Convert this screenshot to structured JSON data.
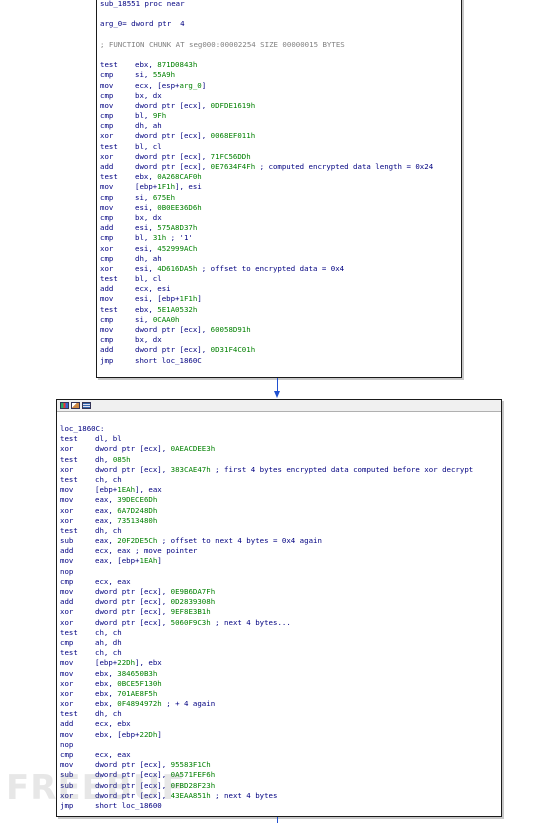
{
  "block1": {
    "lines": [
      {
        "t": "plain",
        "text": "sub_18551 proc near"
      },
      {
        "t": "blank"
      },
      {
        "t": "plain",
        "text": "arg_0= dword ptr  4"
      },
      {
        "t": "blank"
      },
      {
        "t": "comment",
        "text": "; FUNCTION CHUNK AT seg000:00002254 SIZE 00000015 BYTES"
      },
      {
        "t": "blank"
      },
      {
        "t": "ins",
        "m": "test",
        "o": "ebx, 871D0843h"
      },
      {
        "t": "ins",
        "m": "cmp",
        "o": "si, 55A9h"
      },
      {
        "t": "ins",
        "m": "mov",
        "o": "ecx, [esp+arg_0]"
      },
      {
        "t": "ins",
        "m": "cmp",
        "o": "bx, dx"
      },
      {
        "t": "ins",
        "m": "mov",
        "o": "dword ptr [ecx], 0DFDE1619h"
      },
      {
        "t": "ins",
        "m": "cmp",
        "o": "bl, 9Fh"
      },
      {
        "t": "ins",
        "m": "cmp",
        "o": "dh, ah"
      },
      {
        "t": "ins",
        "m": "xor",
        "o": "dword ptr [ecx], 0068EF011h"
      },
      {
        "t": "ins",
        "m": "test",
        "o": "bl, cl"
      },
      {
        "t": "ins",
        "m": "xor",
        "o": "dword ptr [ecx], 71FC56DDh"
      },
      {
        "t": "ins",
        "m": "add",
        "o": "dword ptr [ecx], 0E7634F4Fh",
        "c": "; computed encrypted data length = 0x24"
      },
      {
        "t": "ins",
        "m": "test",
        "o": "ebx, 0A268CAF0h"
      },
      {
        "t": "ins",
        "m": "mov",
        "o": "[ebp+1F1h], esi"
      },
      {
        "t": "ins",
        "m": "cmp",
        "o": "si, 675Eh"
      },
      {
        "t": "ins",
        "m": "mov",
        "o": "esi, 0B0EE36D6h"
      },
      {
        "t": "ins",
        "m": "cmp",
        "o": "bx, dx"
      },
      {
        "t": "ins",
        "m": "add",
        "o": "esi, 575A8D37h"
      },
      {
        "t": "ins",
        "m": "cmp",
        "o": "bl, 31h ; '1'"
      },
      {
        "t": "ins",
        "m": "xor",
        "o": "esi, 452999ACh"
      },
      {
        "t": "ins",
        "m": "cmp",
        "o": "dh, ah"
      },
      {
        "t": "ins",
        "m": "xor",
        "o": "esi, 4D616DA5h",
        "c": "; offset to encrypted data = 0x4"
      },
      {
        "t": "ins",
        "m": "test",
        "o": "bl, cl"
      },
      {
        "t": "ins",
        "m": "add",
        "o": "ecx, esi"
      },
      {
        "t": "ins",
        "m": "mov",
        "o": "esi, [ebp+1F1h]"
      },
      {
        "t": "ins",
        "m": "test",
        "o": "ebx, 5E1A0532h"
      },
      {
        "t": "ins",
        "m": "cmp",
        "o": "si, 0CAA0h"
      },
      {
        "t": "ins",
        "m": "mov",
        "o": "dword ptr [ecx], 60058D91h"
      },
      {
        "t": "ins",
        "m": "cmp",
        "o": "bx, dx"
      },
      {
        "t": "ins",
        "m": "add",
        "o": "dword ptr [ecx], 0D31F4C01h"
      },
      {
        "t": "ins",
        "m": "jmp",
        "o": "short loc_1860C"
      }
    ]
  },
  "block2": {
    "lines": [
      {
        "t": "plain",
        "text": "loc_1860C:"
      },
      {
        "t": "ins",
        "m": "test",
        "o": "dl, bl"
      },
      {
        "t": "ins",
        "m": "xor",
        "o": "dword ptr [ecx], 0AEACDEE3h"
      },
      {
        "t": "ins",
        "m": "test",
        "o": "dh, 085h"
      },
      {
        "t": "ins",
        "m": "xor",
        "o": "dword ptr [ecx], 383CAE47h",
        "c": "; first 4 bytes encrypted data computed before xor decrypt"
      },
      {
        "t": "ins",
        "m": "test",
        "o": "ch, ch"
      },
      {
        "t": "ins",
        "m": "mov",
        "o": "[ebp+1EAh], eax"
      },
      {
        "t": "ins",
        "m": "mov",
        "o": "eax, 39DECE6Dh"
      },
      {
        "t": "ins",
        "m": "xor",
        "o": "eax, 6A7D248Dh"
      },
      {
        "t": "ins",
        "m": "xor",
        "o": "eax, 73513480h"
      },
      {
        "t": "ins",
        "m": "test",
        "o": "dh, ch"
      },
      {
        "t": "ins",
        "m": "sub",
        "o": "eax, 20F2DE5Ch",
        "c": "; offset to next 4 bytes = 0x4 again"
      },
      {
        "t": "ins",
        "m": "add",
        "o": "ecx, eax",
        "c": "; move pointer"
      },
      {
        "t": "ins",
        "m": "mov",
        "o": "eax, [ebp+1EAh]"
      },
      {
        "t": "ins",
        "m": "nop",
        "o": ""
      },
      {
        "t": "ins",
        "m": "cmp",
        "o": "ecx, eax"
      },
      {
        "t": "ins",
        "m": "mov",
        "o": "dword ptr [ecx], 0E9B6DA7Fh"
      },
      {
        "t": "ins",
        "m": "add",
        "o": "dword ptr [ecx], 0D2839308h"
      },
      {
        "t": "ins",
        "m": "xor",
        "o": "dword ptr [ecx], 9EF8E3B1h"
      },
      {
        "t": "ins",
        "m": "xor",
        "o": "dword ptr [ecx], 5060F9C3h",
        "c": "; next 4 bytes..."
      },
      {
        "t": "ins",
        "m": "test",
        "o": "ch, ch"
      },
      {
        "t": "ins",
        "m": "cmp",
        "o": "ah, dh"
      },
      {
        "t": "ins",
        "m": "test",
        "o": "ch, ch"
      },
      {
        "t": "ins",
        "m": "mov",
        "o": "[ebp+22Dh], ebx"
      },
      {
        "t": "ins",
        "m": "mov",
        "o": "ebx, 384650B3h"
      },
      {
        "t": "ins",
        "m": "xor",
        "o": "ebx, 0BCE5F130h"
      },
      {
        "t": "ins",
        "m": "xor",
        "o": "ebx, 701AE8F5h"
      },
      {
        "t": "ins",
        "m": "xor",
        "o": "ebx, 0F4894972h",
        "c": "; + 4 again"
      },
      {
        "t": "ins",
        "m": "test",
        "o": "dh, ch"
      },
      {
        "t": "ins",
        "m": "add",
        "o": "ecx, ebx"
      },
      {
        "t": "ins",
        "m": "mov",
        "o": "ebx, [ebp+22Dh]"
      },
      {
        "t": "ins",
        "m": "nop",
        "o": ""
      },
      {
        "t": "ins",
        "m": "cmp",
        "o": "ecx, eax"
      },
      {
        "t": "ins",
        "m": "mov",
        "o": "dword ptr [ecx], 95583F1Ch"
      },
      {
        "t": "ins",
        "m": "sub",
        "o": "dword ptr [ecx], 0A571FEF6h"
      },
      {
        "t": "ins",
        "m": "sub",
        "o": "dword ptr [ecx], 0FBD28F23h"
      },
      {
        "t": "ins",
        "m": "xor",
        "o": "dword ptr [ecx], 43EAA851h",
        "c": "; next 4 bytes"
      },
      {
        "t": "ins",
        "m": "jmp",
        "o": "short loc_18600"
      }
    ]
  },
  "header_icons": [
    "graph-color-icon",
    "image-edit-icon",
    "text-listing-icon"
  ],
  "watermark": "FREEBUF",
  "colors": {
    "code": "#000080",
    "comment": "#808080",
    "number": "#008000",
    "edge": "#2050d0"
  }
}
